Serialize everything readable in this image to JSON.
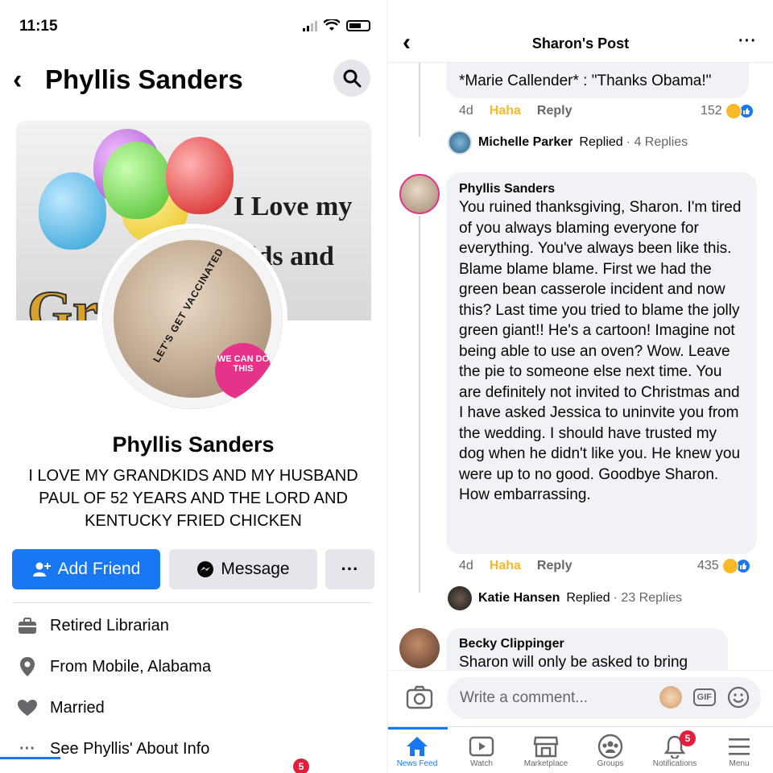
{
  "left": {
    "status": {
      "time": "11:15"
    },
    "header": {
      "name": "Phyllis Sanders"
    },
    "cover": {
      "line1": "I Love my",
      "line2": "ids and",
      "line3": "Gr     ds"
    },
    "avatar": {
      "frame_text": "LET'S GET VACCINATED",
      "badge_text": "WE CAN DO THIS"
    },
    "profile": {
      "name": "Phyllis Sanders",
      "bio": "I LOVE MY GRANDKIDS AND MY HUSBAND PAUL OF 52 YEARS AND THE LORD AND KENTUCKY FRIED CHICKEN"
    },
    "actions": {
      "add_friend": "Add Friend",
      "message": "Message",
      "more": "···"
    },
    "info": {
      "work": "Retired Librarian",
      "from_prefix": "From ",
      "from_place": "Mobile, Alabama",
      "relationship": "Married",
      "about": "See Phyllis' About Info"
    },
    "tabbar": {
      "notification_badge": "5"
    }
  },
  "right": {
    "header": {
      "title": "Sharon's Post",
      "more": "···"
    },
    "comments": [
      {
        "text": "*Marie Callender* : \"Thanks Obama!\"",
        "time": "4d",
        "haha": "Haha",
        "reply": "Reply",
        "reaction_count": "152",
        "replied": {
          "name": "Michelle Parker",
          "action": "Replied",
          "count": "· 4 Replies"
        }
      },
      {
        "author": "Phyllis Sanders",
        "text": "You ruined thanksgiving, Sharon.  I'm tired of you always blaming everyone for everything.  You've always been like this. Blame blame blame.  First we had the green bean casserole incident and now this?  Last time you tried to blame the jolly green giant!! He's a cartoon!  Imagine not being able to use an oven? Wow.  Leave the pie to someone else next time.  You are definitely not invited to Christmas and I have asked Jessica to uninvite you from the wedding.  I should have trusted my dog when he didn't like you.  He knew you were up to no good.  Goodbye Sharon.  How embarrassing.",
        "time": "4d",
        "haha": "Haha",
        "reply": "Reply",
        "reaction_count": "435",
        "replied": {
          "name": "Katie Hansen",
          "action": "Replied",
          "count": "· 23 Replies"
        }
      },
      {
        "author": "Becky Clippinger",
        "text": "Sharon will only be asked to bring"
      }
    ],
    "compose": {
      "placeholder": "Write a comment...",
      "gif": "GIF"
    },
    "tabbar": {
      "tabs": [
        {
          "label": "News Feed",
          "icon": "home-icon"
        },
        {
          "label": "Watch",
          "icon": "watch-icon"
        },
        {
          "label": "Marketplace",
          "icon": "marketplace-icon"
        },
        {
          "label": "Groups",
          "icon": "groups-icon"
        },
        {
          "label": "Notifications",
          "icon": "bell-icon",
          "badge": "5"
        },
        {
          "label": "Menu",
          "icon": "menu-icon"
        }
      ]
    }
  },
  "colors": {
    "accent": "#1877f2",
    "haha": "#f7b928",
    "badge": "#e41e3f",
    "bubble": "#f0f2f5"
  }
}
